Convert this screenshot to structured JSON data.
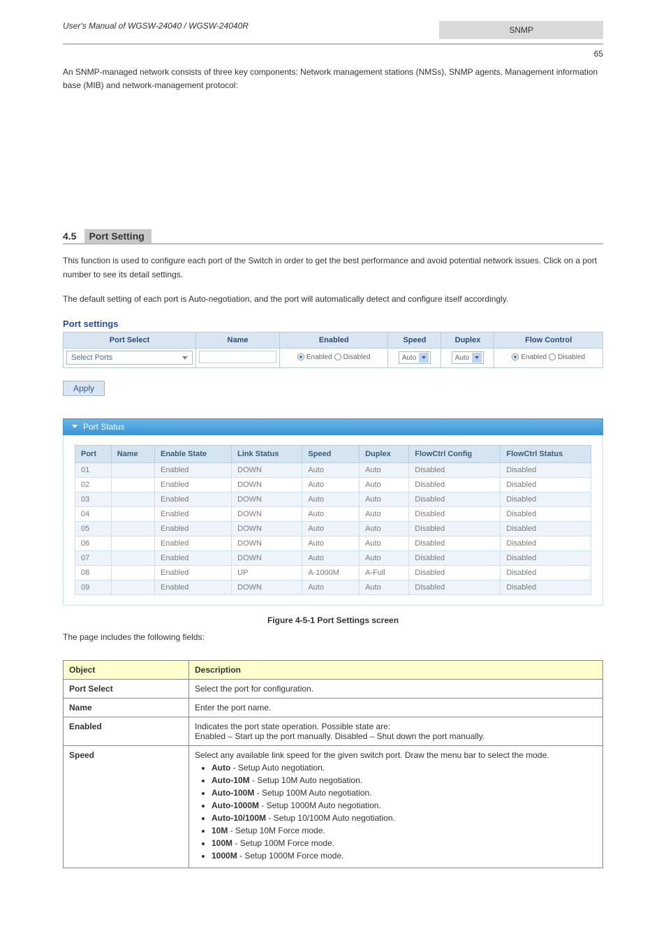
{
  "header": {
    "manual_title": "User's Manual of WGSW-24040 / WGSW-24040R",
    "section_label": "SNMP",
    "page_num": "65"
  },
  "intro_para": "An SNMP-managed network consists of three key components: Network management stations (NMSs), SNMP agents, Management information base (MIB) and network-management protocol:",
  "section": {
    "num": "4.5",
    "title": "Port Setting"
  },
  "para1": "This function is used to configure each port of the Switch in order to get the best performance and avoid potential network issues. Click on a port number to see its detail settings.",
  "para2": "The default setting of each port is Auto-negotiation, and the port will automatically detect and configure itself accordingly.",
  "sub_title": "Port settings",
  "ps_headers": [
    "Port Select",
    "Name",
    "Enabled",
    "Speed",
    "Duplex",
    "Flow Control"
  ],
  "ps_row": {
    "port_select_label": "Select Ports",
    "enabled_on": "Enabled",
    "enabled_off": "Disabled",
    "speed_value": "Auto",
    "duplex_value": "Auto",
    "flow_on": "Enabled",
    "flow_off": "Disabled"
  },
  "apply_label": "Apply",
  "status_bar_title": "Port Status",
  "status_headers": [
    "Port",
    "Name",
    "Enable State",
    "Link Status",
    "Speed",
    "Duplex",
    "FlowCtrl Config",
    "FlowCtrl Status"
  ],
  "status_rows": [
    {
      "port": "01",
      "name": "",
      "enable": "Enabled",
      "link": "DOWN",
      "speed": "Auto",
      "duplex": "Auto",
      "fc_cfg": "Disabled",
      "fc_st": "Disabled"
    },
    {
      "port": "02",
      "name": "",
      "enable": "Enabled",
      "link": "DOWN",
      "speed": "Auto",
      "duplex": "Auto",
      "fc_cfg": "Disabled",
      "fc_st": "Disabled"
    },
    {
      "port": "03",
      "name": "",
      "enable": "Enabled",
      "link": "DOWN",
      "speed": "Auto",
      "duplex": "Auto",
      "fc_cfg": "Disabled",
      "fc_st": "Disabled"
    },
    {
      "port": "04",
      "name": "",
      "enable": "Enabled",
      "link": "DOWN",
      "speed": "Auto",
      "duplex": "Auto",
      "fc_cfg": "Disabled",
      "fc_st": "Disabled"
    },
    {
      "port": "05",
      "name": "",
      "enable": "Enabled",
      "link": "DOWN",
      "speed": "Auto",
      "duplex": "Auto",
      "fc_cfg": "Disabled",
      "fc_st": "Disabled"
    },
    {
      "port": "06",
      "name": "",
      "enable": "Enabled",
      "link": "DOWN",
      "speed": "Auto",
      "duplex": "Auto",
      "fc_cfg": "Disabled",
      "fc_st": "Disabled"
    },
    {
      "port": "07",
      "name": "",
      "enable": "Enabled",
      "link": "DOWN",
      "speed": "Auto",
      "duplex": "Auto",
      "fc_cfg": "Disabled",
      "fc_st": "Disabled"
    },
    {
      "port": "08",
      "name": "",
      "enable": "Enabled",
      "link": "UP",
      "speed": "A-1000M",
      "duplex": "A-Full",
      "fc_cfg": "Disabled",
      "fc_st": "Disabled"
    },
    {
      "port": "09",
      "name": "",
      "enable": "Enabled",
      "link": "DOWN",
      "speed": "Auto",
      "duplex": "Auto",
      "fc_cfg": "Disabled",
      "fc_st": "Disabled"
    }
  ],
  "figure_caption": "Figure 4-5-1 Port Settings screen",
  "figure_desc": "The page includes the following fields:",
  "od_headers": [
    "Object",
    "Description"
  ],
  "od_rows": [
    {
      "obj": "Port Select",
      "desc": "Select the port for configuration."
    },
    {
      "obj": "Name",
      "desc": "Enter the port name."
    },
    {
      "obj": "Enabled",
      "desc_pre": "Indicates the port state operation. Possible state are:",
      "items": [],
      "desc_post": "Enabled – Start up the port manually.  Disabled – Shut down the port manually."
    },
    {
      "obj": "Speed",
      "desc_pre": "Select any available link speed for the given switch port. Draw the menu bar to select the mode.",
      "items": [
        {
          "b": "Auto",
          "t": " - Setup Auto negotiation."
        },
        {
          "b": "Auto-10M",
          "t": " - Setup 10M Auto negotiation."
        },
        {
          "b": "Auto-100M",
          "t": " - Setup 100M Auto negotiation."
        },
        {
          "b": "Auto-1000M",
          "t": " - Setup 1000M Auto negotiation."
        },
        {
          "b": "Auto-10/100M",
          "t": " - Setup 10/100M Auto negotiation."
        },
        {
          "b": "10M",
          "t": " - Setup 10M Force mode."
        },
        {
          "b": "100M",
          "t": " - Setup 100M Force mode."
        },
        {
          "b": "1000M",
          "t": " - Setup 1000M Force mode."
        }
      ],
      "desc_post": ""
    }
  ]
}
